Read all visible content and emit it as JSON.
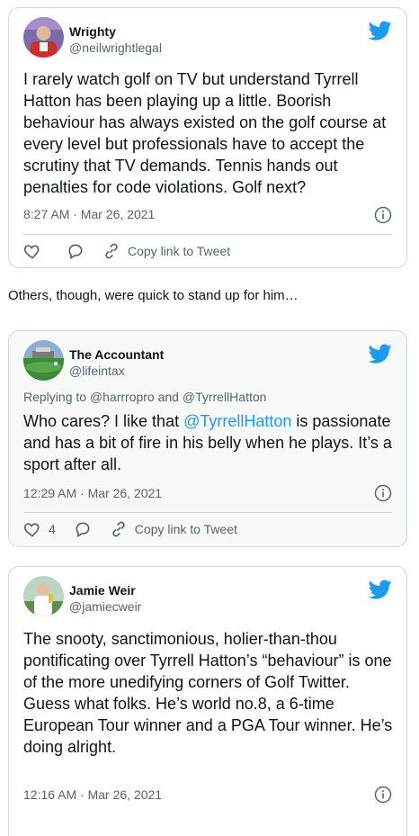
{
  "tweets": [
    {
      "display_name": "Wrighty",
      "handle": "@neilwrightlegal",
      "text": "I rarely watch golf on TV but understand Tyrrell Hatton has been playing up a little. Boorish behaviour has always existed on the golf course at every level but professionals have to accept the scrutiny that TV demands. Tennis hands out penalties for code violations. Golf next?",
      "timestamp": "8:27 AM · Mar 26, 2021",
      "like_count": "",
      "copy_link_label": "Copy link to Tweet"
    },
    {
      "display_name": "The Accountant",
      "handle": "@lifeintax",
      "replying_to": "Replying to @harrropro and @TyrrellHatton",
      "text_before": "Who cares? I like that ",
      "mention": "@TyrrellHatton",
      "text_after": " is passionate and has a bit of fire in his belly when he plays. It’s a sport after all.",
      "timestamp": "12:29 AM · Mar 26, 2021",
      "like_count": "4",
      "copy_link_label": "Copy link to Tweet"
    },
    {
      "display_name": "Jamie Weir",
      "handle": "@jamiecweir",
      "text": "The snooty, sanctimonious, holier-than-thou pontificating over Tyrrell Hatton’s “behaviour” is one of the more unedifying corners of Golf Twitter.\nGuess what folks. He’s world no.8, a 6-time European Tour winner and a PGA Tour winner. He’s doing alright.",
      "timestamp": "12:16 AM · Mar 26, 2021"
    }
  ],
  "interlude": "Others, though, were quick to stand up for him…",
  "colors": {
    "twitter_blue": "#1d9bf0",
    "secondary_text": "#536471",
    "border": "#cfd9de"
  },
  "icons": [
    "twitter-bird-icon",
    "info-icon",
    "heart-icon",
    "reply-icon",
    "link-icon"
  ]
}
